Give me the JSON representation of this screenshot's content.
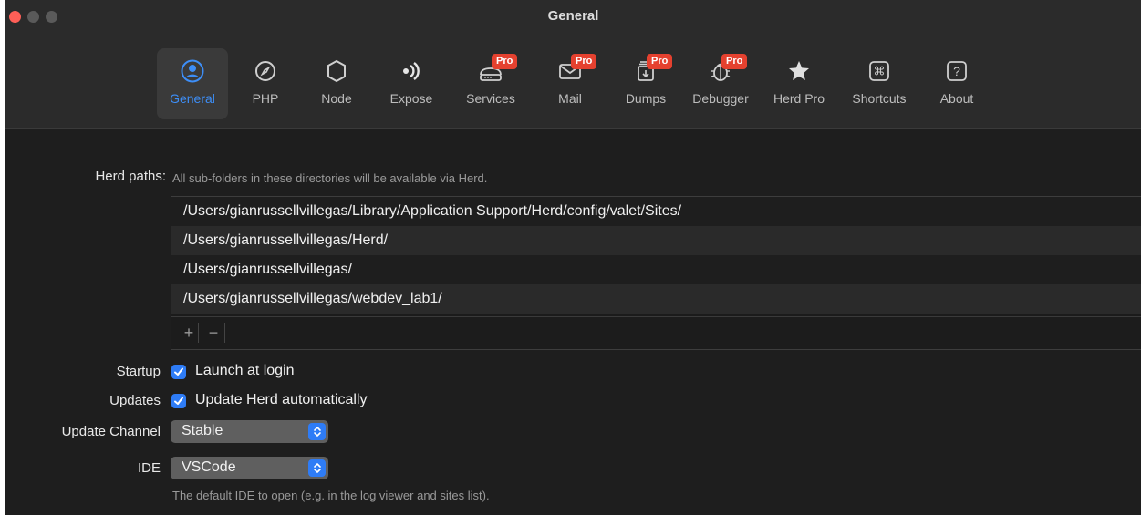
{
  "window": {
    "title": "General"
  },
  "toolbar": {
    "items": [
      {
        "label": "General",
        "icon": "person-circle-icon"
      },
      {
        "label": "PHP",
        "icon": "compass-icon"
      },
      {
        "label": "Node",
        "icon": "hexagon-icon"
      },
      {
        "label": "Expose",
        "icon": "broadcast-icon"
      },
      {
        "label": "Services",
        "icon": "router-icon",
        "badge": "Pro"
      },
      {
        "label": "Mail",
        "icon": "envelope-icon",
        "badge": "Pro"
      },
      {
        "label": "Dumps",
        "icon": "dump-icon",
        "badge": "Pro"
      },
      {
        "label": "Debugger",
        "icon": "ladybug-icon",
        "badge": "Pro"
      },
      {
        "label": "Herd Pro",
        "icon": "star-icon"
      },
      {
        "label": "Shortcuts",
        "icon": "command-icon"
      },
      {
        "label": "About",
        "icon": "question-icon"
      }
    ]
  },
  "herd_paths": {
    "label": "Herd paths:",
    "hint": "All sub-folders in these directories will be available via Herd.",
    "paths": [
      "/Users/gianrussellvillegas/Library/Application Support/Herd/config/valet/Sites/",
      "/Users/gianrussellvillegas/Herd/",
      "/Users/gianrussellvillegas/",
      "/Users/gianrussellvillegas/webdev_lab1/"
    ],
    "add_label": "+",
    "remove_label": "−"
  },
  "startup": {
    "label": "Startup",
    "option": "Launch at login",
    "checked": true
  },
  "updates": {
    "label": "Updates",
    "option": "Update Herd automatically",
    "checked": true
  },
  "update_channel": {
    "label": "Update Channel",
    "value": "Stable"
  },
  "ide": {
    "label": "IDE",
    "value": "VSCode",
    "hint": "The default IDE to open (e.g. in the log viewer and sites list)."
  },
  "colors": {
    "accent": "#2e7cf6",
    "active_label": "#3d8ef7",
    "pro_badge": "#e5412f"
  }
}
